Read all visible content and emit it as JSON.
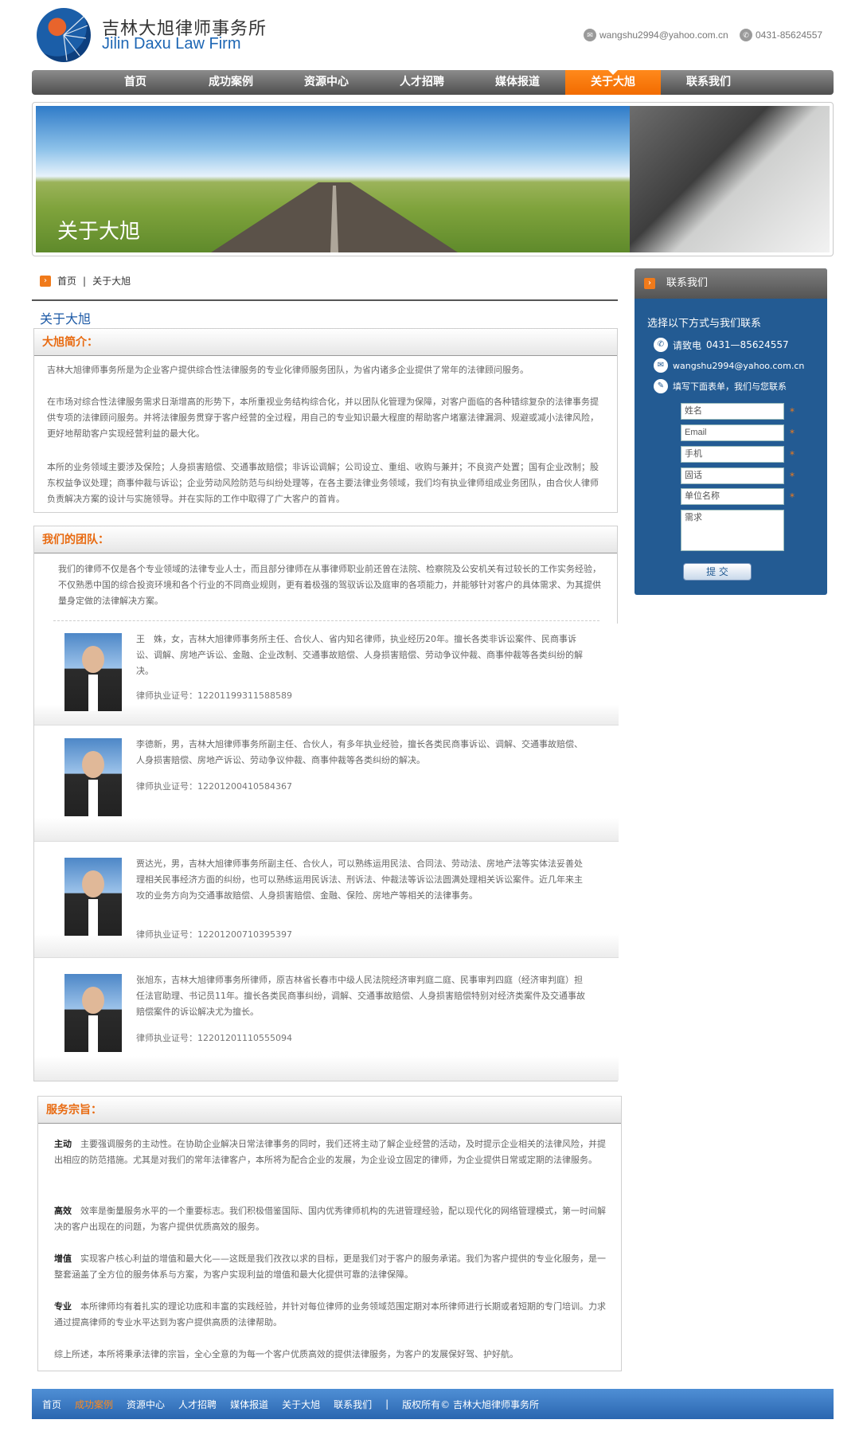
{
  "header": {
    "logo_cn": "吉林大旭律师事务所",
    "logo_en": "Jilin Daxu Law Firm",
    "email": "wangshu2994@yahoo.com.cn",
    "phone": "0431-85624557"
  },
  "nav": {
    "items": [
      "首页",
      "成功案例",
      "资源中心",
      "人才招聘",
      "媒体报道",
      "关于大旭",
      "联系我们"
    ],
    "active": "关于大旭"
  },
  "banner": {
    "title": "关于大旭"
  },
  "breadcrumb": {
    "home": "首页",
    "sep": "|",
    "current": "关于大旭"
  },
  "page_title": "关于大旭",
  "intro": {
    "heading": "大旭简介：",
    "paragraphs": [
      "吉林大旭律师事务所是为企业客户提供综合性法律服务的专业化律师服务团队，为省内诸多企业提供了常年的法律顾问服务。",
      "在市场对综合性法律服务需求日渐增高的形势下，本所重视业务结构综合化，并以团队化管理为保障，对客户面临的各种错综复杂的法律事务提供专项的法律顾问服务。并将法律服务贯穿于客户经营的全过程，用自己的专业知识最大程度的帮助客户堵塞法律漏洞、规避或减小法律风险，更好地帮助客户实现经营利益的最大化。",
      "本所的业务领域主要涉及保险；人身损害赔偿、交通事故赔偿；非诉讼调解；公司设立、重组、收购与兼并；不良资产处置；国有企业改制；股东权益争议处理；商事仲裁与诉讼；企业劳动风险防范与纠纷处理等，在各主要法律业务领域，我们均有执业律师组成业务团队，由合伙人律师负责解决方案的设计与实施领导。并在实际的工作中取得了广大客户的首肯。"
    ]
  },
  "team": {
    "heading": "我们的团队：",
    "intro": "我们的律师不仅是各个专业领域的法律专业人士，而且部分律师在从事律师职业前还曾在法院、检察院及公安机关有过较长的工作实务经验，不仅熟悉中国的综合投资环境和各个行业的不同商业规则，更有着极强的驾驭诉讼及庭审的各项能力，并能够针对客户的具体需求、为其提供量身定做的法律解决方案。",
    "members": [
      {
        "bio": "王　姝，女，吉林大旭律师事务所主任、合伙人、省内知名律师，执业经历20年。擅长各类非诉讼案件、民商事诉讼、调解、房地产诉讼、金融、企业改制、交通事故赔偿、人身损害赔偿、劳动争议仲裁、商事仲裁等各类纠纷的解决。",
        "license": "律师执业证号：12201199311588589"
      },
      {
        "bio": "李德新，男，吉林大旭律师事务所副主任、合伙人，有多年执业经验，擅长各类民商事诉讼、调解、交通事故赔偿、人身损害赔偿、房地产诉讼、劳动争议仲裁、商事仲裁等各类纠纷的解决。",
        "license": "律师执业证号：12201200410584367"
      },
      {
        "bio": "贾达光，男，吉林大旭律师事务所副主任、合伙人，可以熟练运用民法、合同法、劳动法、房地产法等实体法妥善处理相关民事经济方面的纠纷，也可以熟练运用民诉法、刑诉法、仲裁法等诉讼法圆满处理相关诉讼案件。近几年来主攻的业务方向为交通事故赔偿、人身损害赔偿、金融、保险、房地产等相关的法律事务。",
        "license": "律师执业证号：12201200710395397"
      },
      {
        "bio": "张旭东，吉林大旭律师事务所律师，原吉林省长春市中级人民法院经济审判庭二庭、民事审判四庭（经济审判庭）担任法官助理、书记员11年。擅长各类民商事纠纷，调解、交通事故赔偿、人身损害赔偿特别对经济类案件及交通事故赔偿案件的诉讼解决尤为擅长。",
        "license": "律师执业证号：12201201110555094"
      }
    ]
  },
  "service": {
    "heading": "服务宗旨：",
    "items": [
      {
        "term": "主动",
        "text": "主要强调服务的主动性。在协助企业解决日常法律事务的同时，我们还将主动了解企业经营的活动，及时提示企业相关的法律风险，并提出相应的防范措施。尤其是对我们的常年法律客户，本所将为配合企业的发展，为企业设立固定的律师，为企业提供日常或定期的法律服务。"
      },
      {
        "term": "高效",
        "text": "效率是衡量服务水平的一个重要标志。我们积极借鉴国际、国内优秀律师机构的先进管理经验，配以现代化的网络管理模式，第一时间解决的客户出现在的问题，为客户提供优质高效的服务。"
      },
      {
        "term": "增值",
        "text": "实现客户核心利益的增值和最大化——这既是我们孜孜以求的目标，更是我们对于客户的服务承诺。我们为客户提供的专业化服务，是一整套涵盖了全方位的服务体系与方案，为客户实现利益的增值和最大化提供可靠的法律保障。"
      },
      {
        "term": "专业",
        "text": "本所律师均有着扎实的理论功底和丰富的实践经验，并针对每位律师的业务领域范围定期对本所律师进行长期或者短期的专门培训。力求通过提高律师的专业水平达到为客户提供高质的法律帮助。"
      }
    ],
    "summary": "综上所述，本所将秉承法律的宗旨，全心全意的为每一个客户优质高效的提供法律服务，为客户的发展保好驾、护好航。"
  },
  "sidebar": {
    "heading": "联系我们",
    "subtitle": "选择以下方式与我们联系",
    "phone_label": "请致电",
    "phone": "0431—85624557",
    "email": "wangshu2994@yahoo.com.cn",
    "form_hint": "填写下面表单，我们与您联系",
    "fields": {
      "name": "姓名",
      "email": "Email",
      "mobile": "手机",
      "tel": "固话",
      "company": "单位名称",
      "need": "需求"
    },
    "required_mark": "*",
    "submit": "提 交"
  },
  "footer": {
    "items": [
      "首页",
      "成功案例",
      "资源中心",
      "人才招聘",
      "媒体报道",
      "关于大旭",
      "联系我们"
    ],
    "active": "成功案例",
    "sep": "|",
    "copyright": "版权所有© 吉林大旭律师事务所"
  },
  "colors": {
    "accent": "#f07a1a",
    "brand_blue": "#235b93",
    "footer_blue": "#2a66b0"
  }
}
